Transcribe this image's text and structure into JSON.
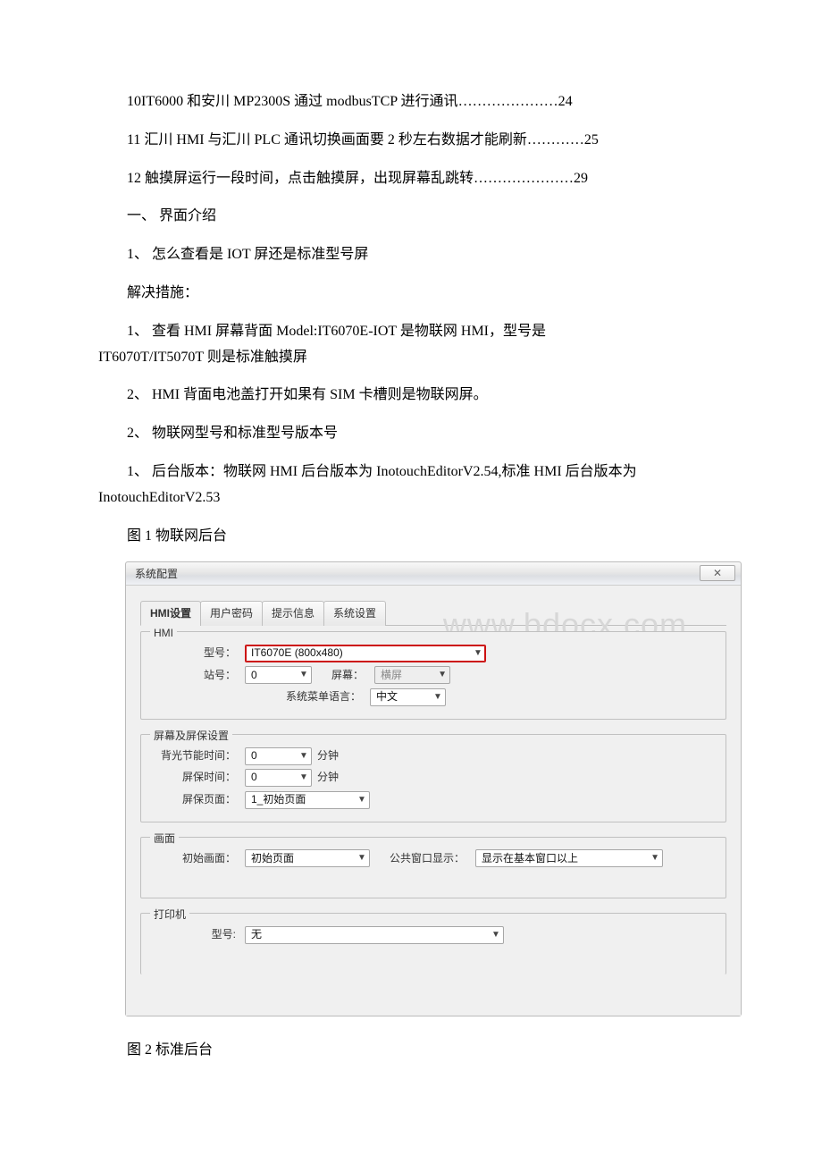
{
  "toc": [
    {
      "text": "10IT6000 和安川 MP2300S 通过 modbusTCP 进行通讯",
      "page": "24"
    },
    {
      "text": "11 汇川 HMI 与汇川 PLC 通讯切换画面要 2 秒左右数据才能刷新",
      "page": "25"
    },
    {
      "text": "12 触摸屏运行一段时间，点击触摸屏，出现屏幕乱跳转",
      "page": "29"
    }
  ],
  "headings": {
    "h1": "一、 界面介绍",
    "q1": "1、 怎么查看是 IOT 屏还是标准型号屏",
    "solution_label": "解决措施：",
    "a1": "1、 查看 HMI 屏幕背面 Model:IT6070E-IOT 是物联网 HMI，型号是 IT6070T/IT5070T 则是标准触摸屏",
    "a1_line1": "1、 查看 HMI 屏幕背面 Model:IT6070E-IOT 是物联网 HMI，型号是",
    "a1_line2": "IT6070T/IT5070T 则是标准触摸屏",
    "a2": "2、 HMI 背面电池盖打开如果有 SIM 卡槽则是物联网屏。",
    "q2": "2、 物联网型号和标准型号版本号",
    "b1": "1、 后台版本：物联网 HMI 后台版本为 InotouchEditorV2.54,标准 HMI 后台版本为",
    "b1b": "InotouchEditorV2.53",
    "fig1": "图 1 物联网后台",
    "fig2": "图 2 标准后台"
  },
  "dialog": {
    "title": "系统配置",
    "close_glyph": "✕",
    "watermark": "www.bdocx.com",
    "tabs": [
      "HMI设置",
      "用户密码",
      "提示信息",
      "系统设置"
    ],
    "hmi_group": {
      "legend": "HMI",
      "model_label": "型号：",
      "model_value": "IT6070E (800x480)",
      "station_label": "站号：",
      "station_value": "0",
      "screen_label": "屏幕：",
      "screen_value": "横屏",
      "lang_label": "系统菜单语言：",
      "lang_value": "中文"
    },
    "saver_group": {
      "legend": "屏幕及屏保设置",
      "backlight_label": "背光节能时间：",
      "backlight_value": "0",
      "minute": "分钟",
      "saver_time_label": "屏保时间：",
      "saver_time_value": "0",
      "saver_page_label": "屏保页面：",
      "saver_page_value": "1_初始页面"
    },
    "screen_group": {
      "legend": "画面",
      "start_label": "初始画面：",
      "start_value": "初始页面",
      "public_label": "公共窗口显示：",
      "public_value": "显示在基本窗口以上"
    },
    "printer_group": {
      "legend": "打印机",
      "model_label": "型号:",
      "model_value": "无"
    }
  }
}
